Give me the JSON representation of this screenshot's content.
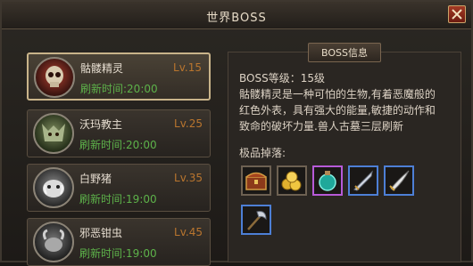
{
  "window": {
    "title": "世界BOSS"
  },
  "boss_list": [
    {
      "name": "骷髅精灵",
      "level": "Lv.15",
      "refresh": "刷新时间:20:00",
      "selected": true
    },
    {
      "name": "沃玛教主",
      "level": "Lv.25",
      "refresh": "刷新时间:20:00",
      "selected": false
    },
    {
      "name": "白野猪",
      "level": "Lv.35",
      "refresh": "刷新时间:19:00",
      "selected": false
    },
    {
      "name": "邪恶钳虫",
      "level": "Lv.45",
      "refresh": "刷新时间:19:00",
      "selected": false
    }
  ],
  "info": {
    "title": "BOSS信息",
    "level_text": "BOSS等级：15级",
    "description_lines": [
      "骷髅精灵是一种可怕的生物,有着恶魔般的",
      "红色外表，具有强大的能量,敏捷的动作和",
      "致命的破坏力量.兽人古墓三层刷新"
    ],
    "drops_label": "极品掉落:",
    "drops": [
      {
        "icon": "treasure-chest-icon",
        "rarity": "normal"
      },
      {
        "icon": "gold-coins-icon",
        "rarity": "normal"
      },
      {
        "icon": "potion-orb-icon",
        "rarity": "purple"
      },
      {
        "icon": "sword-icon",
        "rarity": "blue"
      },
      {
        "icon": "sabre-icon",
        "rarity": "blue"
      },
      {
        "icon": "axe-icon",
        "rarity": "blue"
      }
    ]
  },
  "colors": {
    "level": "#b9752e",
    "refresh": "#5db24a",
    "blue_rarity": "#4d7fd6",
    "purple_rarity": "#b75ad8"
  }
}
